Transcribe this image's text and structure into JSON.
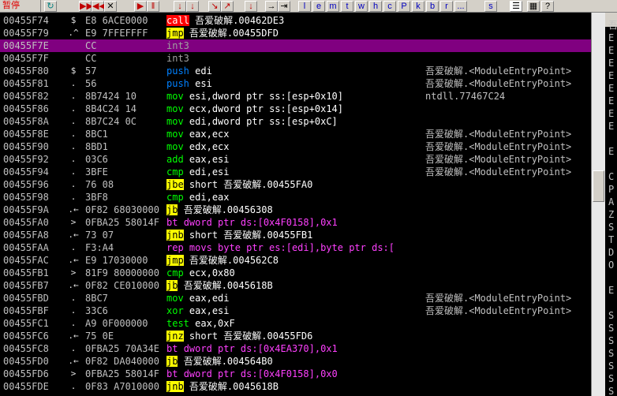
{
  "toolbar": {
    "status": "暂停",
    "buttons": [
      "▶▶",
      "◀◀",
      "✕",
      "▶",
      "‖",
      "↓",
      "↓",
      "↘",
      "↗",
      "↓",
      "→",
      "⇥"
    ],
    "letters": [
      "l",
      "e",
      "m",
      "t",
      "w",
      "h",
      "c",
      "P",
      "k",
      "b",
      "r",
      "...",
      "s"
    ]
  },
  "rows": [
    {
      "addr": "00455F74",
      "bp": "$",
      "hex": "E8 6ACE0000",
      "mnem": "call",
      "cls": "m-call",
      "ops": "吾爱破解.00462DE3",
      "opcls": "op-jmp",
      "cmt": ""
    },
    {
      "addr": "00455F79",
      "bp": ".^",
      "hex": "E9 7FFEFFFF",
      "mnem": "jmp",
      "cls": "m-jmp",
      "ops": "吾爱破解.00455DFD",
      "opcls": "op-jmp",
      "cmt": ""
    },
    {
      "addr": "00455F7E",
      "bp": "",
      "hex": "CC",
      "mnem": "int3",
      "cls": "m-int3",
      "ops": "",
      "opcls": "op",
      "cmt": ""
    },
    {
      "addr": "00455F7F",
      "bp": "",
      "hex": "CC",
      "mnem": "int3",
      "cls": "m-int3",
      "ops": "",
      "opcls": "op",
      "cmt": ""
    },
    {
      "addr": "00455F80",
      "bp": "$",
      "hex": "57",
      "mnem": "push",
      "cls": "m-push",
      "ops": "edi",
      "opcls": "op",
      "cmt": "吾爱破解.<ModuleEntryPoint>"
    },
    {
      "addr": "00455F81",
      "bp": ".",
      "hex": "56",
      "mnem": "push",
      "cls": "m-push",
      "ops": "esi",
      "opcls": "op",
      "cmt": "吾爱破解.<ModuleEntryPoint>"
    },
    {
      "addr": "00455F82",
      "bp": ".",
      "hex": "8B7424 10",
      "mnem": "mov",
      "cls": "m-mov",
      "ops": "esi,dword ptr ss:[esp+0x10]",
      "opcls": "op",
      "cmt": "ntdll.77467C24"
    },
    {
      "addr": "00455F86",
      "bp": ".",
      "hex": "8B4C24 14",
      "mnem": "mov",
      "cls": "m-mov",
      "ops": "ecx,dword ptr ss:[esp+0x14]",
      "opcls": "op",
      "cmt": ""
    },
    {
      "addr": "00455F8A",
      "bp": ".",
      "hex": "8B7C24 0C",
      "mnem": "mov",
      "cls": "m-mov",
      "ops": "edi,dword ptr ss:[esp+0xC]",
      "opcls": "op",
      "cmt": ""
    },
    {
      "addr": "00455F8E",
      "bp": ".",
      "hex": "8BC1",
      "mnem": "mov",
      "cls": "m-mov",
      "ops": "eax,ecx",
      "opcls": "op",
      "cmt": "吾爱破解.<ModuleEntryPoint>"
    },
    {
      "addr": "00455F90",
      "bp": ".",
      "hex": "8BD1",
      "mnem": "mov",
      "cls": "m-mov",
      "ops": "edx,ecx",
      "opcls": "op",
      "cmt": "吾爱破解.<ModuleEntryPoint>"
    },
    {
      "addr": "00455F92",
      "bp": ".",
      "hex": "03C6",
      "mnem": "add",
      "cls": "m-arith",
      "ops": "eax,esi",
      "opcls": "op",
      "cmt": "吾爱破解.<ModuleEntryPoint>"
    },
    {
      "addr": "00455F94",
      "bp": ".",
      "hex": "3BFE",
      "mnem": "cmp",
      "cls": "m-cmp",
      "ops": "edi,esi",
      "opcls": "op",
      "cmt": "吾爱破解.<ModuleEntryPoint>"
    },
    {
      "addr": "00455F96",
      "bp": ".",
      "hex": "76 08",
      "mnem": "jbe",
      "cls": "m-jcc",
      "ops": "short 吾爱破解.00455FA0",
      "opcls": "op-jmp",
      "cmt": ""
    },
    {
      "addr": "00455F98",
      "bp": ".",
      "hex": "3BF8",
      "mnem": "cmp",
      "cls": "m-cmp",
      "ops": "edi,eax",
      "opcls": "op",
      "cmt": ""
    },
    {
      "addr": "00455F9A",
      "bp": ".←",
      "hex": "0F82 68030000",
      "mnem": "jb",
      "cls": "m-jcc",
      "ops": "吾爱破解.00456308",
      "opcls": "op-jmp",
      "cmt": ""
    },
    {
      "addr": "00455FA0",
      "bp": ">",
      "hex": "0FBA25 58014F",
      "mnem": "bt",
      "cls": "m-bt",
      "ops": "dword ptr ds:[0x4F0158],0x1",
      "opcls": "op-ptr",
      "cmt": ""
    },
    {
      "addr": "00455FA8",
      "bp": ".←",
      "hex": "73 07",
      "mnem": "jnb",
      "cls": "m-jcc",
      "ops": "short 吾爱破解.00455FB1",
      "opcls": "op-jmp",
      "cmt": ""
    },
    {
      "addr": "00455FAA",
      "bp": ".",
      "hex": "F3:A4",
      "mnem": "rep movs",
      "cls": "m-rep",
      "ops": "byte ptr es:[edi],byte ptr ds:[",
      "opcls": "op-ptr",
      "cmt": ""
    },
    {
      "addr": "00455FAC",
      "bp": ".←",
      "hex": "E9 17030000",
      "mnem": "jmp",
      "cls": "m-jmp",
      "ops": "吾爱破解.004562C8",
      "opcls": "op-jmp",
      "cmt": ""
    },
    {
      "addr": "00455FB1",
      "bp": ">",
      "hex": "81F9 80000000",
      "mnem": "cmp",
      "cls": "m-cmp",
      "ops": "ecx,0x80",
      "opcls": "op",
      "cmt": ""
    },
    {
      "addr": "00455FB7",
      "bp": ".←",
      "hex": "0F82 CE010000",
      "mnem": "jb",
      "cls": "m-jcc",
      "ops": "吾爱破解.0045618B",
      "opcls": "op-jmp",
      "cmt": ""
    },
    {
      "addr": "00455FBD",
      "bp": ".",
      "hex": "8BC7",
      "mnem": "mov",
      "cls": "m-mov",
      "ops": "eax,edi",
      "opcls": "op",
      "cmt": "吾爱破解.<ModuleEntryPoint>"
    },
    {
      "addr": "00455FBF",
      "bp": ".",
      "hex": "33C6",
      "mnem": "xor",
      "cls": "m-arith",
      "ops": "eax,esi",
      "opcls": "op",
      "cmt": "吾爱破解.<ModuleEntryPoint>"
    },
    {
      "addr": "00455FC1",
      "bp": ".",
      "hex": "A9 0F000000",
      "mnem": "test",
      "cls": "m-test",
      "ops": "eax,0xF",
      "opcls": "op",
      "cmt": ""
    },
    {
      "addr": "00455FC6",
      "bp": ".←",
      "hex": "75 0E",
      "mnem": "jnz",
      "cls": "m-jcc",
      "ops": "short 吾爱破解.00455FD6",
      "opcls": "op-jmp",
      "cmt": ""
    },
    {
      "addr": "00455FC8",
      "bp": ".",
      "hex": "0FBA25 70A34E",
      "mnem": "bt",
      "cls": "m-bt",
      "ops": "dword ptr ds:[0x4EA370],0x1",
      "opcls": "op-ptr",
      "cmt": ""
    },
    {
      "addr": "00455FD0",
      "bp": ".←",
      "hex": "0F82 DA040000",
      "mnem": "jb",
      "cls": "m-jcc",
      "ops": "吾爱破解.004564B0",
      "opcls": "op-jmp",
      "cmt": ""
    },
    {
      "addr": "00455FD6",
      "bp": ">",
      "hex": "0FBA25 58014F",
      "mnem": "bt",
      "cls": "m-bt",
      "ops": "dword ptr ds:[0x4F0158],0x0",
      "opcls": "op-ptr",
      "cmt": ""
    },
    {
      "addr": "00455FDE",
      "bp": ".",
      "hex": "0F83 A7010000",
      "mnem": "jnb",
      "cls": "m-jcc",
      "ops": "吾爱破解.0045618B",
      "opcls": "op-jmp",
      "cmt": ""
    }
  ],
  "registers": [
    "吾",
    "E",
    "E",
    "E",
    "E",
    "E",
    "E",
    "E",
    "E",
    "",
    "E",
    "",
    "C",
    "P",
    "A",
    "Z",
    "S",
    "T",
    "D",
    "O",
    "",
    "E",
    "",
    "S",
    "S",
    "S",
    "S",
    "S",
    "S",
    "S"
  ]
}
